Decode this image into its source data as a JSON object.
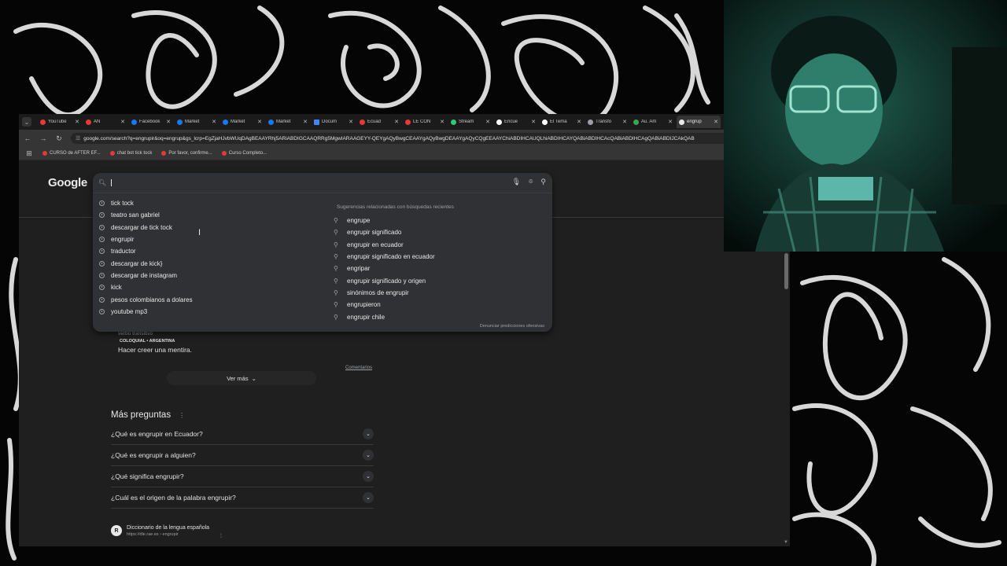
{
  "tabs": [
    {
      "title": "YouTube",
      "color": "#e53935"
    },
    {
      "title": "AN",
      "color": "#e53935"
    },
    {
      "title": "Facebook",
      "color": "#1877f2"
    },
    {
      "title": "Market",
      "color": "#1877f2"
    },
    {
      "title": "Market",
      "color": "#1877f2"
    },
    {
      "title": "Market",
      "color": "#1877f2"
    },
    {
      "title": "Docum",
      "color": "#4285f4"
    },
    {
      "title": "Ecuad",
      "color": "#e53935"
    },
    {
      "title": "LE CON",
      "color": "#e53935"
    },
    {
      "title": "Stream",
      "color": "#2ecc71"
    },
    {
      "title": "Encue",
      "color": "#ffffff"
    },
    {
      "title": "El Tema",
      "color": "#ffffff"
    },
    {
      "title": "Transfo",
      "color": "#9aa0a6"
    },
    {
      "title": "Au. Am",
      "color": "#34a853"
    },
    {
      "title": "engrup",
      "color": "#e8e8e8"
    }
  ],
  "toolbar": {
    "url": "google.com/search?q=engrupir&oq=engrup&gs_lcrp=EgZjaHJvbWUqDAgBEAAYRhj5ARiABDIGCAAQRRg5MgwIARAAGEYY-QEYgAQyBwgCEAAYgAQyBwgDEAAYgAQyCQgEEAAYChiABDIHCAUQLhiABDIHCAYQABiABDIHCAcQABiABDIHCAgQABiABDIJCAkQAB"
  },
  "bookmarks": [
    {
      "label": "CURSO de AFTER EF...",
      "color": "#e53935"
    },
    {
      "label": "chat bot tick tock",
      "color": "#e53935"
    },
    {
      "label": "Por favor, confirme...",
      "color": "#e53935"
    },
    {
      "label": "Curso Completo...",
      "color": "#e53935"
    }
  ],
  "google": {
    "logo": "Google"
  },
  "search": {
    "value": "",
    "placeholder": ""
  },
  "recent_searches": [
    "tick tock",
    "teatro san gabriel",
    "descargar de tick tock",
    "engrupir",
    "traductor",
    "descargar de kick}",
    "descargar de instagram",
    "kick",
    "pesos colombianos a dolares",
    "youtube mp3"
  ],
  "related": {
    "heading": "Sugerencias relacionadas con búsquedas recientes",
    "items": [
      "engrupe",
      "engrupir significado",
      "engrupir en ecuador",
      "engrupir significado en ecuador",
      "engripar",
      "engrupir significado y origen",
      "sinónimos de engrupir",
      "engrupieron",
      "engrupir chile"
    ],
    "report": "Denunciar predicciones ofensivas"
  },
  "dictionary": {
    "part_of_speech": "verbo transitivo",
    "tag": "COLOQUIAL • ARGENTINA",
    "definition": "Hacer creer una mentira.",
    "comments": "Comentarios",
    "see_more": "Ver más"
  },
  "people_also_ask": {
    "title": "Más preguntas",
    "questions": [
      "¿Qué es engrupir en Ecuador?",
      "¿Qué es engrupir a alguien?",
      "¿Qué significa engrupir?",
      "¿Cuál es el origen de la palabra engrupir?"
    ]
  },
  "source": {
    "name": "Diccionario de la lengua española",
    "url": "https://dle.rae.es › engrupir"
  }
}
